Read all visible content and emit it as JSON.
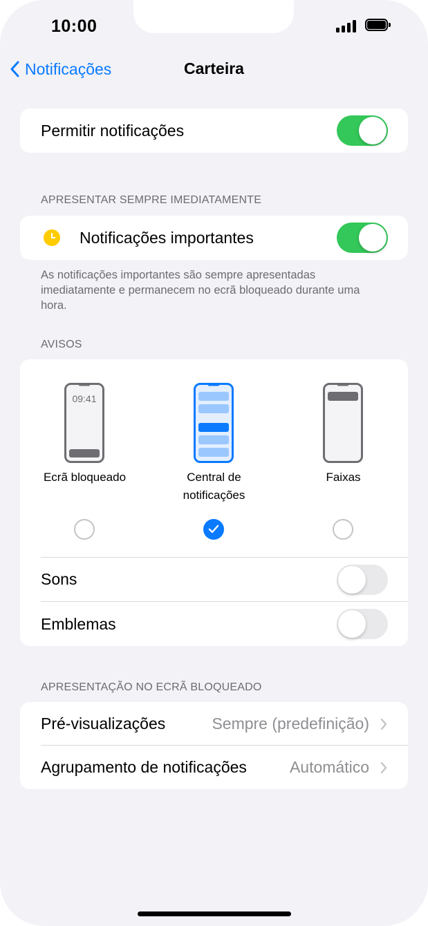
{
  "status_bar": {
    "time": "10:00"
  },
  "nav": {
    "back_label": "Notificações",
    "title": "Carteira"
  },
  "allow": {
    "label": "Permitir notificações",
    "enabled": true
  },
  "immediate": {
    "header": "APRESENTAR SEMPRE IMEDIATAMENTE",
    "label": "Notificações importantes",
    "enabled": true,
    "footer": "As notificações importantes são sempre apresentadas imediatamente e permanecem no ecrã bloqueado durante uma hora."
  },
  "alerts": {
    "header": "AVISOS",
    "styles": [
      {
        "label": "Ecrã bloqueado",
        "checked": false,
        "clock": "09:41"
      },
      {
        "label": "Central de notificações",
        "checked": true
      },
      {
        "label": "Faixas",
        "checked": false
      }
    ],
    "sounds_label": "Sons",
    "sounds_enabled": false,
    "badges_label": "Emblemas",
    "badges_enabled": false
  },
  "lock_screen": {
    "header": "APRESENTAÇÃO NO ECRÃ BLOQUEADO",
    "previews_label": "Pré-visualizações",
    "previews_value": "Sempre (predefinição)",
    "grouping_label": "Agrupamento de notificações",
    "grouping_value": "Automático"
  },
  "colors": {
    "accent": "#0a7aff",
    "toggle_on": "#34c759",
    "background": "#f2f2f7"
  }
}
